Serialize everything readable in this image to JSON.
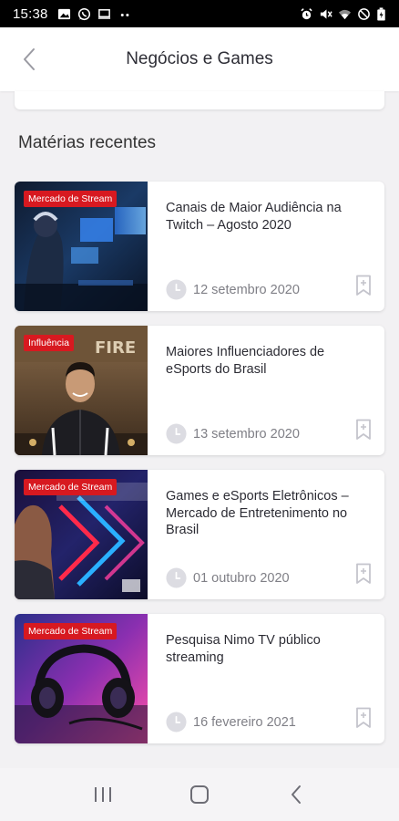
{
  "status_bar": {
    "time": "15:38",
    "left_icons": [
      "image-icon",
      "whatsapp-icon",
      "monitor-icon",
      "more-dots-icon"
    ],
    "right_icons": [
      "alarm-icon",
      "mute-icon",
      "wifi-icon",
      "dnd-icon",
      "battery-icon"
    ]
  },
  "header": {
    "title": "Negócios e Games",
    "back_icon": "chevron-left-icon"
  },
  "section": {
    "title": "Matérias recentes"
  },
  "articles": [
    {
      "badge": "Mercado de Stream",
      "title": "Canais de Maior Audiência na Twitch – Agosto 2020",
      "date": "12 setembro 2020"
    },
    {
      "badge": "Influência",
      "title": "Maiores Influenciadores de eSports do Brasil",
      "date": "13 setembro 2020"
    },
    {
      "badge": "Mercado de Stream",
      "title": "Games e eSports Eletrônicos – Mercado de Entretenimento no Brasil",
      "date": "01 outubro 2020"
    },
    {
      "badge": "Mercado de Stream",
      "title": "Pesquisa Nimo TV público streaming",
      "date": "16 fevereiro 2021"
    }
  ],
  "nav": {
    "recent_icon": "recent-apps-icon",
    "home_icon": "home-icon",
    "back_icon": "back-icon"
  },
  "colors": {
    "badge": "#d71920",
    "background": "#f2f1f3",
    "card": "#ffffff",
    "date_text": "#7f7f86"
  }
}
